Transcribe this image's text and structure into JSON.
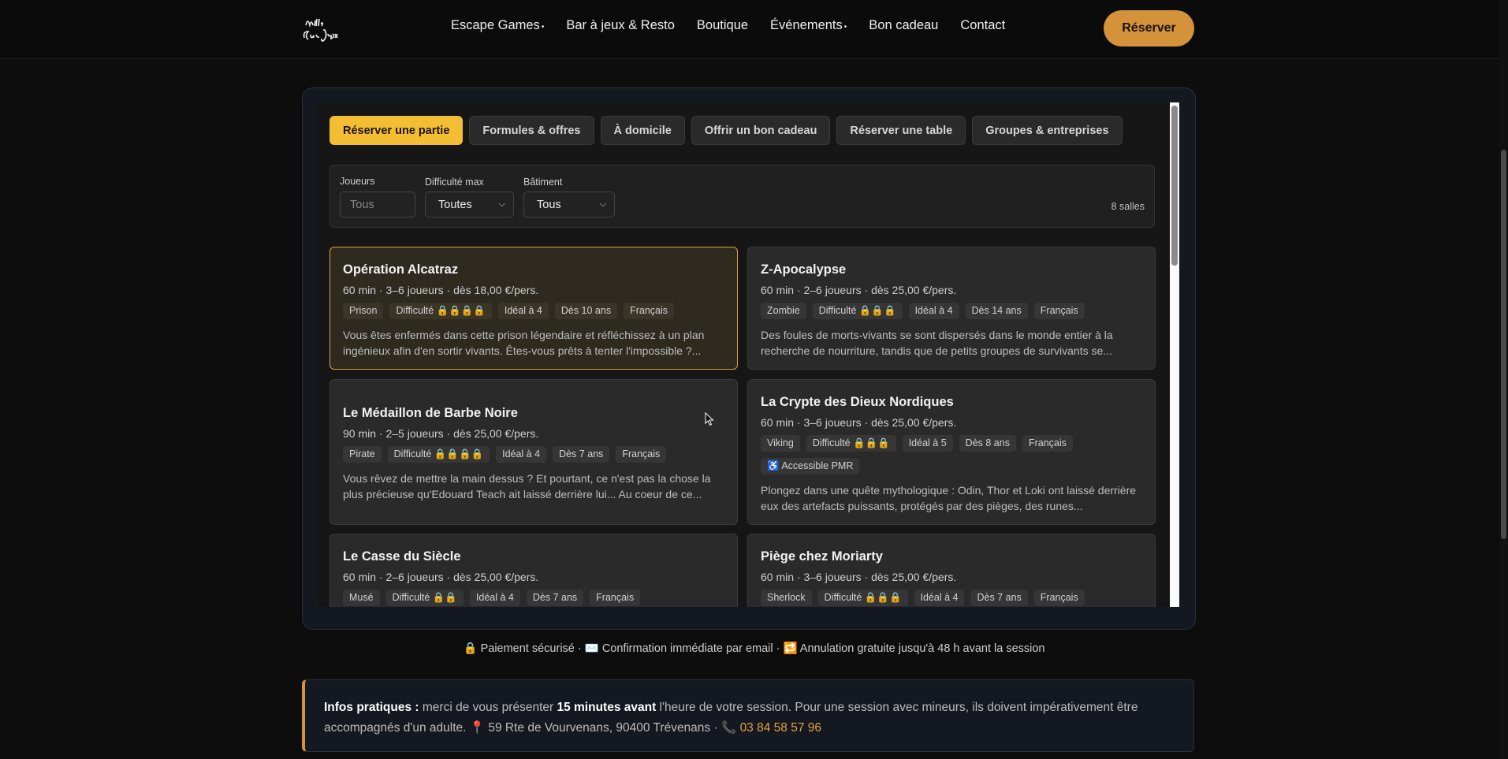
{
  "header": {
    "logo_text": "Mille & un Jeux",
    "nav": [
      {
        "label": "Escape Games",
        "dropdown": true
      },
      {
        "label": "Bar à jeux & Resto",
        "dropdown": false
      },
      {
        "label": "Boutique",
        "dropdown": false
      },
      {
        "label": "Événements",
        "dropdown": true
      },
      {
        "label": "Bon cadeau",
        "dropdown": false
      },
      {
        "label": "Contact",
        "dropdown": false
      }
    ],
    "dropdown_marker": "•",
    "reserve_label": "Réserver"
  },
  "tabs": [
    {
      "label": "Réserver une partie",
      "active": true
    },
    {
      "label": "Formules & offres",
      "active": false
    },
    {
      "label": "À domicile",
      "active": false
    },
    {
      "label": "Offrir un bon cadeau",
      "active": false
    },
    {
      "label": "Réserver une table",
      "active": false
    },
    {
      "label": "Groupes & entreprises",
      "active": false
    }
  ],
  "filters": {
    "players_label": "Joueurs",
    "players_placeholder": "Tous",
    "difficulty_label": "Difficulté max",
    "difficulty_value": "Toutes",
    "building_label": "Bâtiment",
    "building_value": "Tous",
    "count": "8 salles"
  },
  "rooms": [
    {
      "title": "Opération Alcatraz",
      "meta": "60 min · 3–6 joueurs · dès 18,00 €/pers.",
      "tags": [
        "Prison",
        "Difficulté 🔒🔒🔒🔒",
        "Idéal à 4",
        "Dès 10 ans",
        "Français"
      ],
      "desc": "Vous êtes enfermés dans cette prison légendaire et réfléchissez à un plan ingénieux afin d'en sortir vivants. Êtes-vous prêts à tenter l'impossible ?...",
      "selected": true
    },
    {
      "title": "Z-Apocalypse",
      "meta": "60 min · 2–6 joueurs · dès 25,00 €/pers.",
      "tags": [
        "Zombie",
        "Difficulté 🔒🔒🔒",
        "Idéal à 4",
        "Dès 14 ans",
        "Français"
      ],
      "desc": "Des foules de morts-vivants se sont dispersés dans le monde entier à la recherche de nourriture, tandis que de petits groupes de survivants se...",
      "selected": false
    },
    {
      "title": "Le Médaillon de Barbe Noire",
      "meta": "90 min · 2–5 joueurs · dès 25,00 €/pers.",
      "tags": [
        "Pirate",
        "Difficulté 🔒🔒🔒🔒",
        "Idéal à 4",
        "Dès 7 ans",
        "Français"
      ],
      "desc": "Vous rêvez de mettre la main dessus ? Et pourtant, ce n'est pas la chose la plus précieuse qu'Edouard Teach ait laissé derrière lui... Au coeur de ce...",
      "selected": false
    },
    {
      "title": "La Crypte des Dieux Nordiques",
      "meta": "60 min · 3–6 joueurs · dès 25,00 €/pers.",
      "tags": [
        "Viking",
        "Difficulté 🔒🔒🔒",
        "Idéal à 5",
        "Dès 8 ans",
        "Français",
        "♿ Accessible PMR"
      ],
      "desc": "Plongez dans une quête mythologique : Odin, Thor et Loki ont laissé derrière eux des artefacts puissants, protégés par des pièges, des runes...",
      "selected": false
    },
    {
      "title": "Le Casse du Siècle",
      "meta": "60 min · 2–6 joueurs · dès 25,00 €/pers.",
      "tags": [
        "Musé",
        "Difficulté 🔒🔒",
        "Idéal à 4",
        "Dès 7 ans",
        "Français"
      ],
      "desc": "",
      "selected": false
    },
    {
      "title": "Piège chez Moriarty",
      "meta": "60 min · 3–6 joueurs · dès 25,00 €/pers.",
      "tags": [
        "Sherlock",
        "Difficulté 🔒🔒🔒",
        "Idéal à 4",
        "Dès 7 ans",
        "Français"
      ],
      "desc": "",
      "selected": false
    }
  ],
  "trust_line": "🔒 Paiement sécurisé · ✉️ Confirmation immédiate par email · 🔁 Annulation gratuite jusqu'à 48 h avant la session",
  "infos": {
    "label": "Infos pratiques :",
    "text1": " merci de vous présenter ",
    "emphasis": "15 minutes avant",
    "text2": " l'heure de votre session. Pour une session avec mineurs, ils doivent impérativement être accompagnés d'un adulte. 📍 59 Rte de Vourvenans, 90400 Trévenans · 📞 ",
    "phone": "03 84 58 57 96"
  },
  "colors": {
    "accent_gold": "#f3bd34",
    "reserve_orange": "#d4933a",
    "selected_border": "#d9a437"
  }
}
